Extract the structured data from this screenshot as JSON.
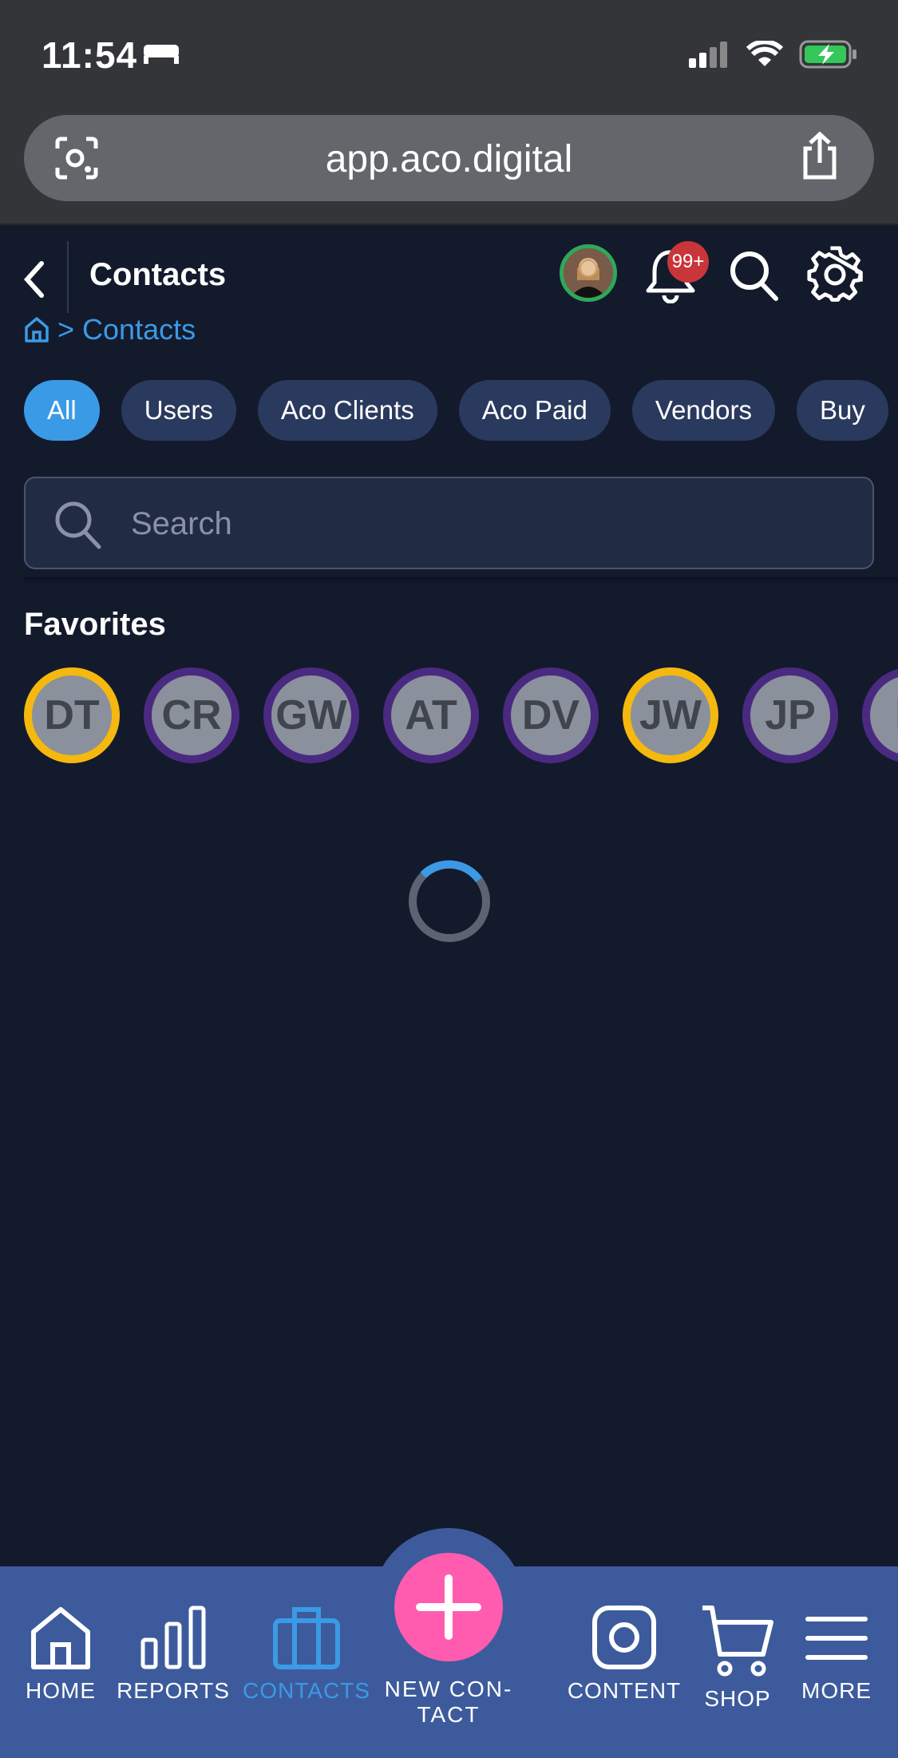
{
  "status_bar": {
    "time": "11:54"
  },
  "browser": {
    "url": "app.aco.digital"
  },
  "header": {
    "title": "Contacts",
    "notification_count": "99+"
  },
  "breadcrumb": {
    "separator": ">",
    "current": "Contacts"
  },
  "filter_chips": [
    "All",
    "Users",
    "Aco Clients",
    "Aco Paid",
    "Vendors",
    "Buy"
  ],
  "active_chip": "All",
  "search": {
    "placeholder": "Search"
  },
  "favorites": {
    "title": "Favorites",
    "items": [
      {
        "initials": "DT",
        "ring": "#f5b80e"
      },
      {
        "initials": "CR",
        "ring": "#4a2a80"
      },
      {
        "initials": "GW",
        "ring": "#4a2a80"
      },
      {
        "initials": "AT",
        "ring": "#4a2a80"
      },
      {
        "initials": "DV",
        "ring": "#4a2a80"
      },
      {
        "initials": "JW",
        "ring": "#f5b80e"
      },
      {
        "initials": "JP",
        "ring": "#4a2a80"
      },
      {
        "initials": "D",
        "ring": "#4a2a80"
      }
    ]
  },
  "bottom_nav": {
    "home": "HOME",
    "reports": "REPORTS",
    "contacts": "CONTACTS",
    "new_contact_line1": "NEW CON-",
    "new_contact_line2": "TACT",
    "content": "CONTENT",
    "shop": "SHOP",
    "more": "MORE"
  },
  "colors": {
    "accent": "#3b9ae6",
    "fab": "#ff5cb0",
    "nav_bg": "#3d5b9c",
    "bg": "#131a2c"
  }
}
